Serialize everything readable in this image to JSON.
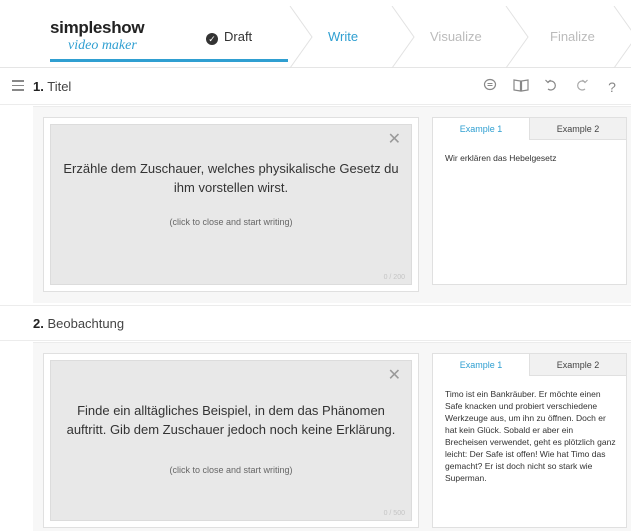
{
  "header": {
    "logo_main": "simpleshow",
    "logo_sub": "video maker",
    "steps": {
      "draft": "Draft",
      "write": "Write",
      "visualize": "Visualize",
      "finalize": "Finalize"
    }
  },
  "toolbar_icons": [
    "comment-icon",
    "book-icon",
    "undo-icon",
    "redo-icon",
    "help-icon"
  ],
  "help_label": "?",
  "sections": [
    {
      "number": "1.",
      "title": "Titel",
      "hint": "Erzähle dem Zuschauer, welches physikalische Gesetz du ihm vorstellen wirst.",
      "hint_sub": "(click to close and start writing)",
      "counter": "0 / 200",
      "tab1": "Example 1",
      "tab2": "Example 2",
      "example_text": "Wir erklären das Hebelgesetz"
    },
    {
      "number": "2.",
      "title": "Beobachtung",
      "hint": "Finde ein alltägliches Beispiel, in dem das Phänomen auftritt. Gib dem Zuschauer jedoch noch keine Erklärung.",
      "hint_sub": "(click to close and start writing)",
      "counter": "0 / 500",
      "tab1": "Example 1",
      "tab2": "Example 2",
      "example_text": "Timo ist ein Bankräuber. Er möchte einen Safe knacken und probiert verschiedene Werkzeuge aus, um ihn zu öffnen. Doch er hat kein Glück. Sobald er aber ein Brecheisen verwendet, geht es plötzlich ganz leicht: Der Safe ist offen! Wie hat Timo das gemacht? Er ist doch nicht so stark wie Superman."
    }
  ],
  "colors": {
    "accent": "#2f9fd1",
    "inactive_step": "#bbbbbb",
    "hint_bg": "#e8e8e8"
  }
}
